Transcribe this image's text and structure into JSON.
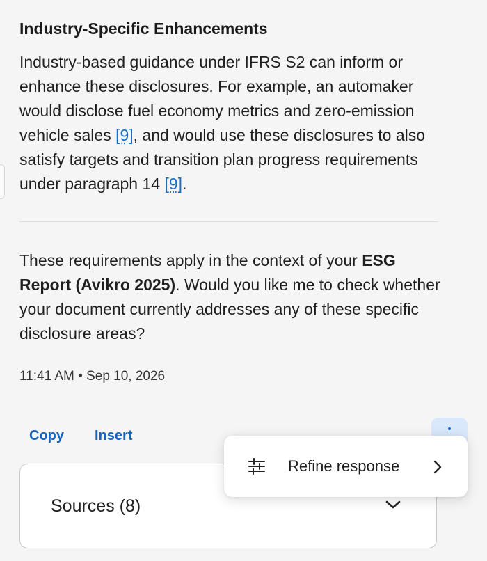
{
  "section": {
    "heading": "Industry-Specific Enhancements",
    "para1_text": "Industry-based guidance under IFRS S2 can inform or enhance these disclosures. For example, an automaker would disclose fuel economy metrics and zero-emission vehicle sales ",
    "para1_cite1": "[9]",
    "para1_text2": ", and would use these disclosures to also satisfy targets and transition plan progress requirements under paragraph 14 ",
    "para1_cite2": "[9]",
    "para1_end": "."
  },
  "followup": {
    "text1": "These requirements apply in the context of your ",
    "bold": "ESG Report (Avikro 2025)",
    "text2": ". Would you like me to check whether your document currently addresses any of these specific disclosure areas?"
  },
  "timestamp": "11:41 AM • Sep 10, 2026",
  "actions": {
    "copy_label": "Copy",
    "insert_label": "Insert"
  },
  "menu": {
    "refine_label": "Refine response",
    "icon": "sliders-icon"
  },
  "sources": {
    "label": "Sources (8)"
  },
  "colors": {
    "accent": "#1565c0",
    "link": "#1a6fc4",
    "more_bg": "#d9e8fb",
    "background": "#f5f5f5"
  }
}
